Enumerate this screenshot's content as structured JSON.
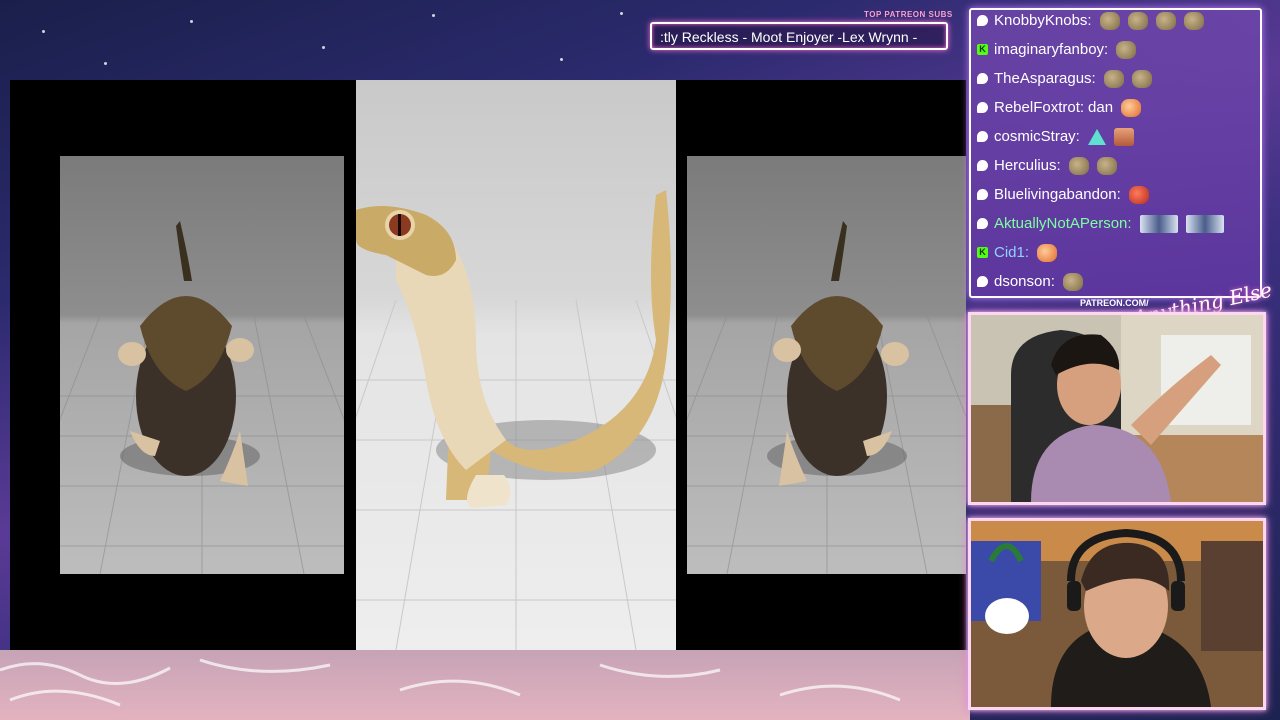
{
  "overlay": {
    "patreon_label": "TOP PATREON SUBS",
    "ticker_text": ":tly Reckless - Moot Enjoyer -Lex Wrynn -"
  },
  "chat": {
    "messages": [
      {
        "user": "KnobbyKnobs:",
        "badge": "bubble",
        "message": "",
        "emotes": [
          "emote",
          "emote",
          "emote",
          "emote"
        ],
        "color": "white"
      },
      {
        "user": "imaginaryfanboy:",
        "badge": "k",
        "message": "",
        "emotes": [
          "emote"
        ],
        "color": "white"
      },
      {
        "user": "TheAsparagus:",
        "badge": "bubble",
        "message": "",
        "emotes": [
          "emote",
          "emote"
        ],
        "color": "white"
      },
      {
        "user": "RebelFoxtrot:",
        "badge": "bubble",
        "message": "dan",
        "emotes": [
          "fox"
        ],
        "color": "white"
      },
      {
        "user": "cosmicStray:",
        "badge": "bubble",
        "message": "",
        "emotes": [
          "tri",
          "face"
        ],
        "color": "white"
      },
      {
        "user": "Herculius:",
        "badge": "bubble",
        "message": "",
        "emotes": [
          "emote",
          "emote"
        ],
        "color": "white"
      },
      {
        "user": "Bluelivingabandon:",
        "badge": "bubble",
        "message": "",
        "emotes": [
          "red"
        ],
        "color": "white"
      },
      {
        "user": "AktuallyNotAPerson:",
        "badge": "bubble",
        "message": "",
        "emotes": [
          "wide",
          "wide"
        ],
        "color": "green"
      },
      {
        "user": "Cid1:",
        "badge": "k",
        "message": "",
        "emotes": [
          "fox"
        ],
        "color": "blue"
      },
      {
        "user": "dsonson:",
        "badge": "bubble",
        "message": "",
        "emotes": [
          "emote"
        ],
        "color": "white"
      }
    ]
  },
  "webcam": {
    "patreon_url": "PATREON.COM/",
    "logo_script": "Anything Else"
  },
  "colors": {
    "accent_pink": "#ff6bd0",
    "accent_cyan": "#7df9ff",
    "chat_bg": "#6e46aa"
  }
}
